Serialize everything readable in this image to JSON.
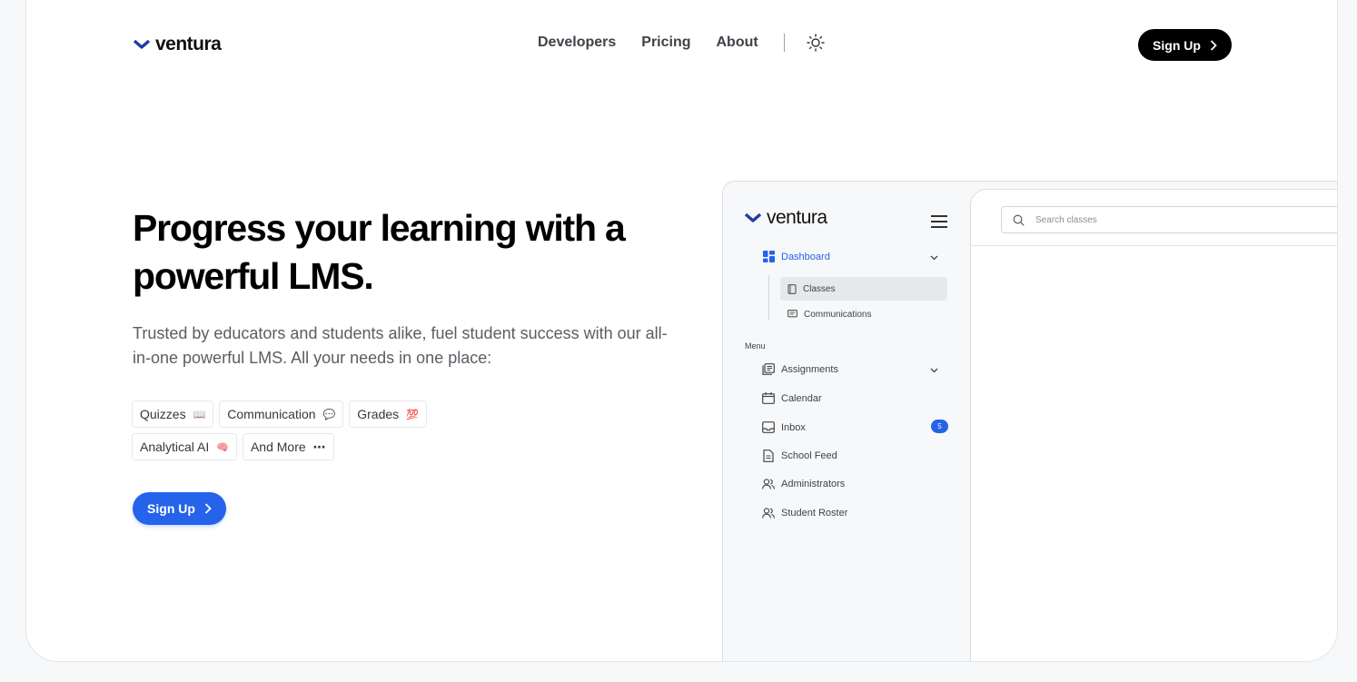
{
  "brand": {
    "name": "ventura"
  },
  "nav": {
    "links": [
      "Developers",
      "Pricing",
      "About"
    ],
    "theme_icon": "sun-icon",
    "signup_label": "Sign Up"
  },
  "hero": {
    "title": "Progress your learning with a powerful LMS.",
    "subtitle": "Trusted by educators and students alike, fuel student success with our all-in-one powerful LMS. All your needs in one place:",
    "tags": [
      {
        "label": "Quizzes",
        "emoji": "📖"
      },
      {
        "label": "Communication",
        "emoji": "💬"
      },
      {
        "label": "Grades",
        "emoji": "💯"
      },
      {
        "label": "Analytical AI",
        "emoji": "🧠"
      },
      {
        "label": "And More",
        "emoji": "⋯"
      }
    ],
    "cta_label": "Sign Up"
  },
  "preview": {
    "brand": "ventura",
    "dashboard": {
      "label": "Dashboard",
      "sub_items": [
        "Classes",
        "Communications"
      ]
    },
    "menu_label": "Menu",
    "menu_items": [
      {
        "label": "Assignments",
        "icon": "assignments-icon"
      },
      {
        "label": "Calendar",
        "icon": "calendar-icon"
      },
      {
        "label": "Inbox",
        "icon": "inbox-icon",
        "badge": "5"
      },
      {
        "label": "School Feed",
        "icon": "document-icon"
      },
      {
        "label": "Administrators",
        "icon": "users-icon"
      },
      {
        "label": "Student Roster",
        "icon": "users-icon"
      }
    ],
    "search": {
      "placeholder": "Search classes"
    }
  },
  "colors": {
    "accent": "#2563eb",
    "dark": "#000000",
    "logo": "#1e40af"
  }
}
